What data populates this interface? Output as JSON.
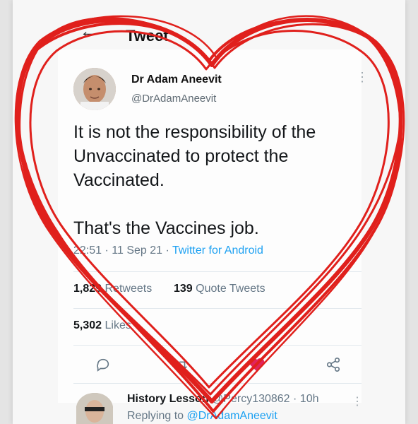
{
  "header": {
    "title": "Tweet",
    "back_icon": "arrow-left-icon"
  },
  "tweet": {
    "author_name": "Dr Adam Aneevit",
    "author_handle": "@DrAdamAneevit",
    "text": "It is not the responsibility of the\nUnvaccinated to protect the\nVaccinated.\n\nThat's the Vaccines job.",
    "time": "22:51",
    "date": "11 Sep 21",
    "source": "Twitter for Android",
    "sep": " · "
  },
  "stats": {
    "retweets_count": "1,829",
    "retweets_label": "Retweets",
    "quote_count": "139",
    "quote_label": "Quote Tweets",
    "likes_count": "5,302",
    "likes_label": "Likes"
  },
  "actions": {
    "reply_icon": "reply-icon",
    "retweet_icon": "retweet-icon",
    "like_icon": "heart-icon",
    "share_icon": "share-icon",
    "like_color": "#e0245e"
  },
  "reply": {
    "author_name": "History Lesson",
    "handle": "@Percy130862",
    "time": "10h",
    "replying_label": "Replying to",
    "replying_handle": "@DrAdamAneevit"
  },
  "overlay": {
    "heart_color": "#e0201c",
    "accent": "#1da1f2"
  }
}
